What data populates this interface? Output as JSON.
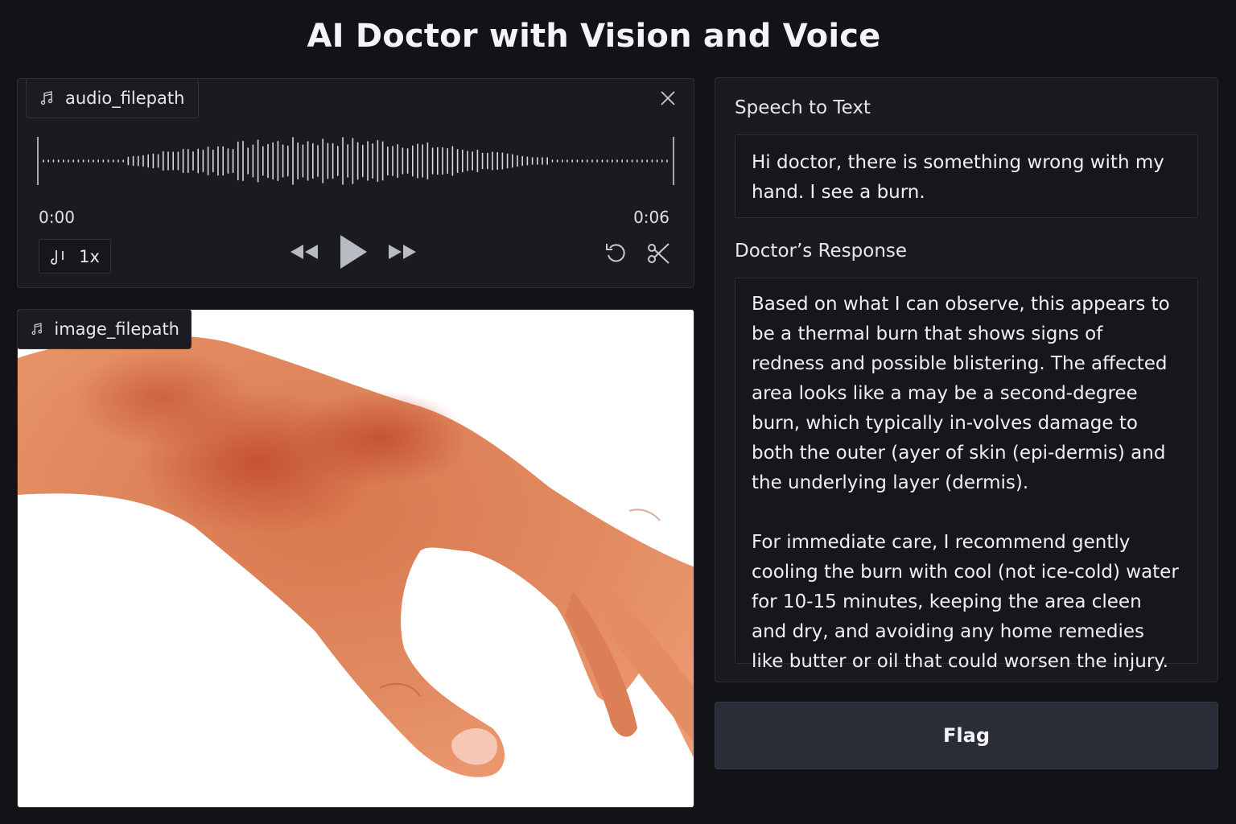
{
  "app": {
    "title": "AI Doctor with Vision and Voice"
  },
  "audio": {
    "label": "audio_filepath",
    "icon": "music-note-icon",
    "time_start": "0:00",
    "time_end": "0:06",
    "speed": "1x"
  },
  "image": {
    "label": "image_filepath",
    "icon": "music-note-icon"
  },
  "speech_to_text": {
    "label": "Speech to Text",
    "value": "Hi doctor, there is something wrong with my hand. I see a burn."
  },
  "doctor_response": {
    "label": "Doctor’s Response",
    "paragraph1": "Based on what I can observe, this appears to be a thermal burn that shows signs of redness and possible blistering. The affected area looks like a may be a second-degree burn, which typically in-volves damage to both the outer (ayer of skin (epi-dermis) and the underlying layer (dermis).",
    "paragraph2": "For immediate care, I recommend gently cooling the burn with cool (not ice-cold) water for 10-15 minutes, keeping the area cleen and dry, and avoiding any home remedies like butter or oil that could worsen the injury."
  },
  "actions": {
    "flag_label": "Flag"
  },
  "colors": {
    "background": "#121316",
    "panel": "#1a1b1f",
    "button": "#2a2d38",
    "text": "#e9eaee"
  }
}
